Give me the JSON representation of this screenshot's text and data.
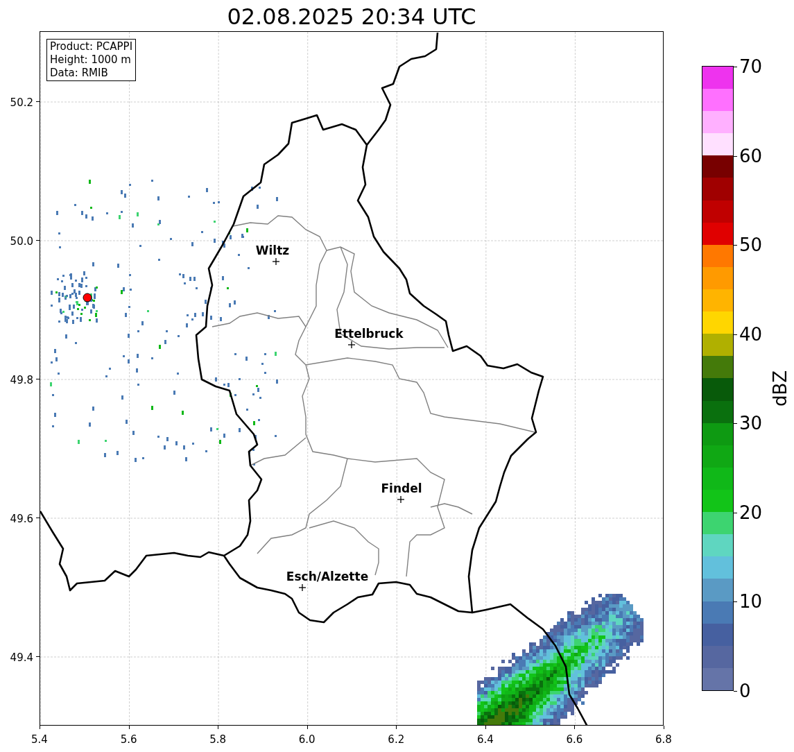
{
  "title": "02.08.2025 20:34 UTC",
  "info_box": [
    "Product: PCAPPI",
    "Height: 1000 m",
    "Data: RMIB"
  ],
  "map": {
    "xticks": [
      "5.4",
      "5.6",
      "5.8",
      "6.0",
      "6.2",
      "6.4",
      "6.6",
      "6.8"
    ],
    "yticks": [
      "50.2",
      "50.0",
      "49.8",
      "49.6",
      "49.4"
    ],
    "places": [
      {
        "name": "Wiltz"
      },
      {
        "name": "Ettelbruck"
      },
      {
        "name": "Findel"
      },
      {
        "name": "Esch/Alzette"
      }
    ]
  },
  "colorbar": {
    "label": "dBZ",
    "ticks": [
      "70",
      "60",
      "50",
      "40",
      "30",
      "20",
      "10",
      "0"
    ],
    "bands": [
      {
        "color": "#6574a8"
      },
      {
        "color": "#5667a0"
      },
      {
        "color": "#4660a0"
      },
      {
        "color": "#4a7ab4"
      },
      {
        "color": "#5a9ac4"
      },
      {
        "color": "#62c0dc"
      },
      {
        "color": "#5fd6c0"
      },
      {
        "color": "#3dd470"
      },
      {
        "color": "#12c418"
      },
      {
        "color": "#10b818"
      },
      {
        "color": "#10a814"
      },
      {
        "color": "#0e9a12"
      },
      {
        "color": "#0a700e"
      },
      {
        "color": "#085a0a"
      },
      {
        "color": "#447a0a"
      },
      {
        "color": "#b0b000"
      },
      {
        "color": "#ffd600"
      },
      {
        "color": "#ffb400"
      },
      {
        "color": "#ff9a00"
      },
      {
        "color": "#ff7800"
      },
      {
        "color": "#e00000"
      },
      {
        "color": "#c00000"
      },
      {
        "color": "#a00000"
      },
      {
        "color": "#780000"
      },
      {
        "color": "#ffe0ff"
      },
      {
        "color": "#ffb0ff"
      },
      {
        "color": "#ff70ff"
      },
      {
        "color": "#ee33ee"
      }
    ]
  }
}
